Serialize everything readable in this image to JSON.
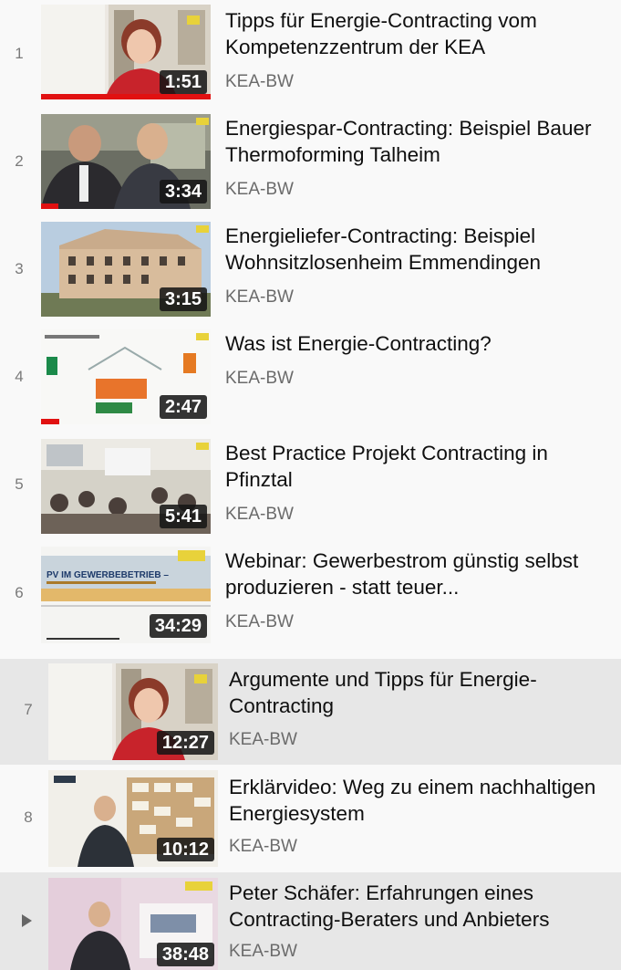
{
  "playlist": {
    "current_marker": "▶",
    "items": [
      {
        "index": "1",
        "duration": "1:51",
        "title": "Tipps für Energie-Contracting vom Kompetenzzentrum der KEA",
        "channel": "KEA-BW",
        "watched": 1.0
      },
      {
        "index": "2",
        "duration": "3:34",
        "title": "Energiespar-Contracting: Beispiel Bauer Thermoforming Talheim",
        "channel": "KEA-BW",
        "watched": 0.1
      },
      {
        "index": "3",
        "duration": "3:15",
        "title": "Energieliefer-Contracting: Beispiel Wohnsitzlosenheim Emmendingen",
        "channel": "KEA-BW",
        "watched": 0
      },
      {
        "index": "4",
        "duration": "2:47",
        "title": "Was ist Energie-Contracting?",
        "channel": "KEA-BW",
        "watched": 0.11
      },
      {
        "index": "5",
        "duration": "5:41",
        "title": "Best Practice Projekt Contracting in Pfinztal",
        "channel": "KEA-BW",
        "watched": 0
      },
      {
        "index": "6",
        "duration": "34:29",
        "title": "Webinar: Gewerbestrom günstig selbst produzieren - statt teuer...",
        "channel": "KEA-BW",
        "watched": 0,
        "slide_heading": "PV IM GEWERBEBETRIEB –"
      },
      {
        "index": "7",
        "duration": "12:27",
        "title": "Argumente und Tipps für Energie-Contracting",
        "channel": "KEA-BW",
        "watched": 0
      },
      {
        "index": "8",
        "duration": "10:12",
        "title": "Erklärvideo: Weg zu einem nachhaltigen Energiesystem",
        "channel": "KEA-BW",
        "watched": 0
      },
      {
        "index": "",
        "duration": "38:48",
        "title": "Peter Schäfer: Erfahrungen eines Contracting-Beraters und Anbieters",
        "channel": "KEA-BW",
        "watched": 0,
        "current": true
      }
    ]
  },
  "colors": {
    "progress": "#e11111",
    "highlight_row": "#e7e7e7",
    "background": "#f9f9f9"
  }
}
